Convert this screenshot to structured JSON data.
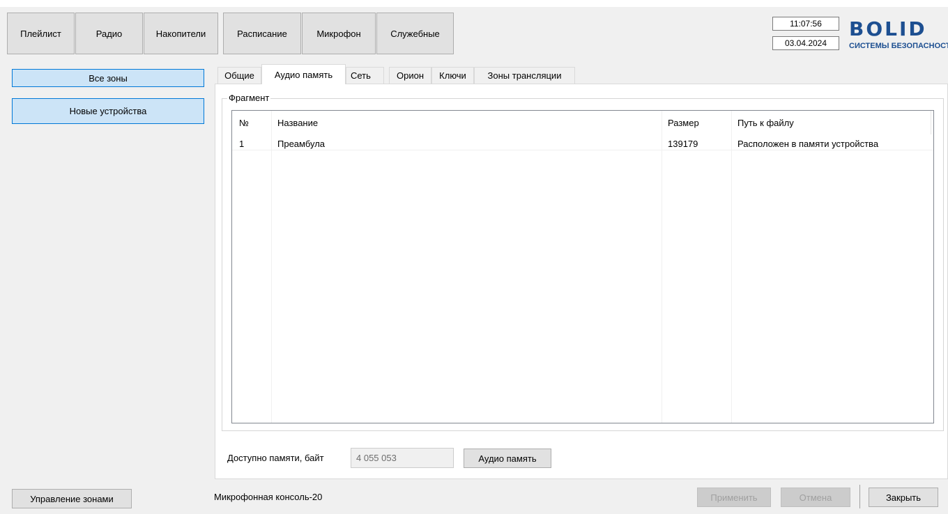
{
  "nav": {
    "buttons": [
      "Плейлист",
      "Радио",
      "Накопители",
      "Расписание",
      "Микрофон",
      "Служебные"
    ]
  },
  "clock": {
    "time": "11:07:56",
    "date": "03.04.2024"
  },
  "logo": {
    "word": "BOLID",
    "subtitle": "СИСТЕМЫ БЕЗОПАСНОСТИ"
  },
  "zones": {
    "all": "Все зоны",
    "new_devices": "Новые устройства",
    "manage": "Управление зонами"
  },
  "tabs": [
    "Общие",
    "Аудио память",
    "Сеть",
    "Орион",
    "Ключи",
    "Зоны трансляции"
  ],
  "active_tab": "Аудио память",
  "fragment": {
    "group_label": "Фрагмент",
    "columns": [
      "№",
      "Название",
      "Размер",
      "Путь к файлу"
    ],
    "rows": [
      [
        "1",
        "Преамбула",
        "139179",
        "Расположен в памяти устройства"
      ]
    ]
  },
  "memory": {
    "label": "Доступно памяти, байт",
    "value": "4 055 053",
    "button": "Аудио память"
  },
  "status": {
    "device": "Микрофонная консоль-20"
  },
  "actions": {
    "apply": "Применить",
    "cancel": "Отмена",
    "close": "Закрыть"
  },
  "colors": {
    "accent": "#0078d7",
    "selected_bg": "#cce4f7",
    "logo": "#1d4f91"
  }
}
